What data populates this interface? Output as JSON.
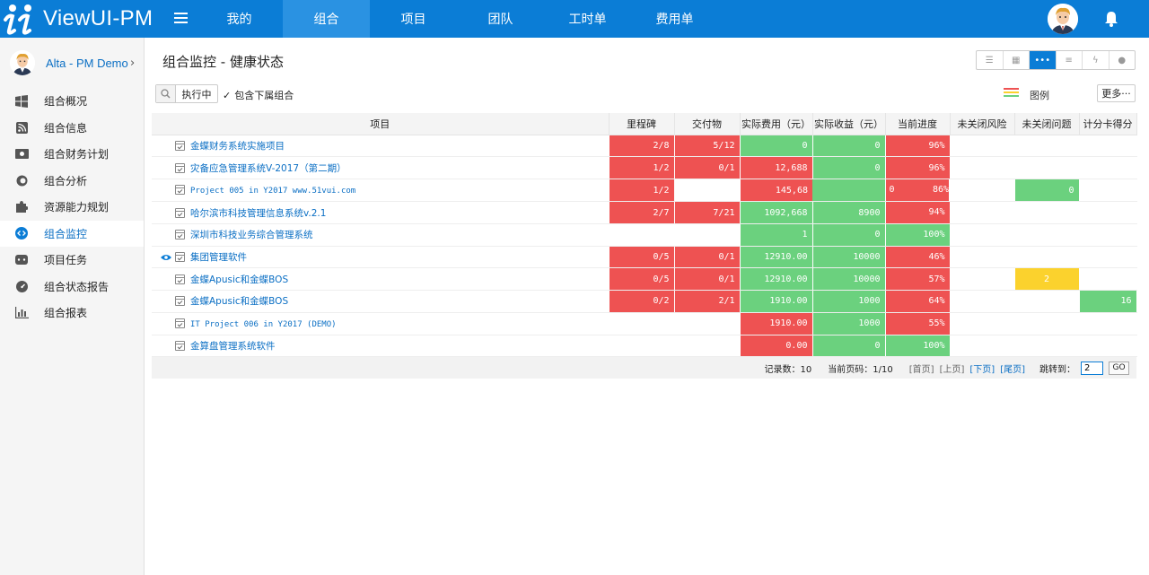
{
  "app": {
    "title": "ViewUI-PM",
    "colors": {
      "primary": "#0b7dd6",
      "red": "#ee5252",
      "green": "#6bd17e",
      "yellow": "#fbd22d"
    }
  },
  "nav": {
    "items": [
      {
        "label": "我的",
        "active": false
      },
      {
        "label": "组合",
        "active": true
      },
      {
        "label": "项目",
        "active": false
      },
      {
        "label": "团队",
        "active": false
      },
      {
        "label": "工时单",
        "active": false
      },
      {
        "label": "费用单",
        "active": false
      }
    ]
  },
  "sidebar": {
    "user": "Alta - PM Demo",
    "items": [
      {
        "label": "组合概况",
        "icon": "windows-icon"
      },
      {
        "label": "组合信息",
        "icon": "rss-icon"
      },
      {
        "label": "组合财务计划",
        "icon": "money-icon"
      },
      {
        "label": "组合分析",
        "icon": "stackexchange-icon"
      },
      {
        "label": "资源能力规划",
        "icon": "puzzle-icon"
      },
      {
        "label": "组合监控",
        "icon": "code-icon",
        "active": true
      },
      {
        "label": "项目任务",
        "icon": "gamepad-icon"
      },
      {
        "label": "组合状态报告",
        "icon": "dashboard-icon"
      },
      {
        "label": "组合报表",
        "icon": "bar-chart-icon"
      }
    ]
  },
  "page": {
    "title": "组合监控 - 健康状态",
    "status_filter": "执行中",
    "include_children": "包含下属组合",
    "legend_label": "图例",
    "more_label": "更多···"
  },
  "table": {
    "columns": [
      "项目",
      "里程碑",
      "交付物",
      "实际费用（元）",
      "实际收益（元）",
      "当前进度",
      "未关闭风险",
      "未关闭问题",
      "计分卡得分"
    ],
    "rows": [
      {
        "name": "金蝶财务系统实施项目",
        "milestone": "2/8",
        "deliverable": "5/12",
        "cost": "0",
        "revenue": "0",
        "progress": "96%",
        "risk": "",
        "issue": "",
        "score": ""
      },
      {
        "name": "灾备应急管理系统V-2017（第二期）",
        "milestone": "1/2",
        "deliverable": "0/1",
        "cost": "12,688",
        "revenue": "0",
        "progress": "96%",
        "risk": "",
        "issue": "",
        "score": ""
      },
      {
        "name": "Project 005 in Y2017 www.51vui.com",
        "milestone": "1/2",
        "deliverable": "",
        "cost": "145,68",
        "revenue": "",
        "progress_left": "0",
        "progress": "86%",
        "risk": "",
        "issue": "0",
        "score": ""
      },
      {
        "name": "哈尔滨市科技管理信息系统v.2.1",
        "milestone": "2/7",
        "deliverable": "7/21",
        "cost": "1092,668",
        "revenue": "8900",
        "progress": "94%",
        "risk": "",
        "issue": "",
        "score": ""
      },
      {
        "name": "深圳市科技业务综合管理系统",
        "milestone": "",
        "deliverable": "",
        "cost": "1",
        "revenue": "0",
        "progress": "100%",
        "risk": "",
        "issue": "",
        "score": ""
      },
      {
        "name": "集团管理软件",
        "milestone": "0/5",
        "deliverable": "0/1",
        "cost": "12910.00",
        "revenue": "10000",
        "progress": "46%",
        "risk": "",
        "issue": "",
        "score": ""
      },
      {
        "name": "金蝶Apusic和金蝶BOS",
        "milestone": "0/5",
        "deliverable": "0/1",
        "cost": "12910.00",
        "revenue": "10000",
        "progress": "57%",
        "risk": "",
        "issue": "2",
        "score": ""
      },
      {
        "name": "金蝶Apusic和金蝶BOS",
        "milestone": "0/2",
        "deliverable": "2/1",
        "cost": "1910.00",
        "revenue": "1000",
        "progress": "64%",
        "risk": "",
        "issue": "",
        "score": "16"
      },
      {
        "name": "IT Project 006 in Y2017 (DEMO)",
        "milestone": "",
        "deliverable": "",
        "cost": "1910.00",
        "revenue": "1000",
        "progress": "55%",
        "risk": "",
        "issue": "",
        "score": ""
      },
      {
        "name": "金算盘管理系统软件",
        "milestone": "",
        "deliverable": "",
        "cost": "0.00",
        "revenue": "0",
        "progress": "100%",
        "risk": "",
        "issue": "",
        "score": ""
      }
    ]
  },
  "pager": {
    "records_label": "记录数：",
    "records": "10",
    "current_label": "当前页码：",
    "current": "1/10",
    "first": "[首页]",
    "prev": "[上页]",
    "next": "[下页]",
    "last": "[尾页]",
    "jump_label": "跳转到：",
    "jump_value": "2",
    "go": "GO"
  }
}
